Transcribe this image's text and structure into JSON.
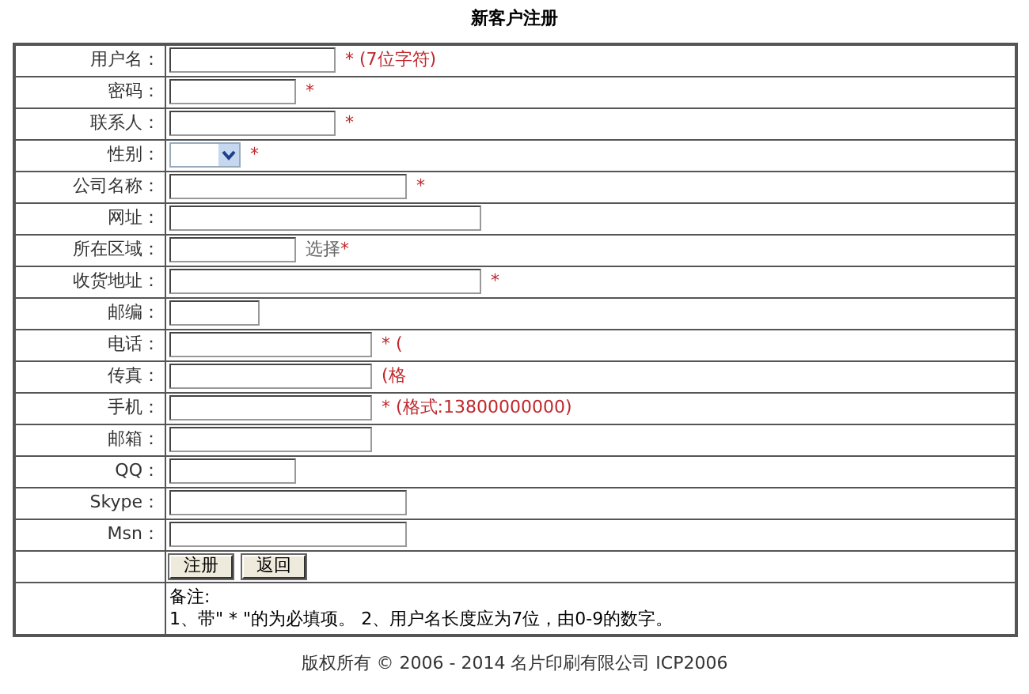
{
  "title": "新客户注册",
  "fields": [
    {
      "label": "用户名：",
      "kind": "text",
      "hint": "* (7位字符)"
    },
    {
      "label": "密码：",
      "kind": "text",
      "hint": "*"
    },
    {
      "label": "联系人：",
      "kind": "text",
      "hint": "*"
    },
    {
      "label": "性别：",
      "kind": "select",
      "hint": "*"
    },
    {
      "label": "公司名称：",
      "kind": "text",
      "hint": "*"
    },
    {
      "label": "网址：",
      "kind": "text"
    },
    {
      "label": "所在区域：",
      "kind": "text",
      "link": "选择",
      "hint": "*"
    },
    {
      "label": "收货地址：",
      "kind": "text",
      "hint": "*"
    },
    {
      "label": "邮编：",
      "kind": "text"
    },
    {
      "label": "电话：",
      "kind": "text",
      "hint": "* ("
    },
    {
      "label": "传真：",
      "kind": "text",
      "hint": "(格"
    },
    {
      "label": "手机：",
      "kind": "text",
      "hint": "* (格式:13800000000)"
    },
    {
      "label": "邮箱：",
      "kind": "text"
    },
    {
      "label": "QQ：",
      "kind": "text"
    },
    {
      "label": "Skype：",
      "kind": "text"
    },
    {
      "label": "Msn：",
      "kind": "text"
    }
  ],
  "buttons": [
    "注册",
    "返回"
  ],
  "notes": {
    "heading": "备注:",
    "text": "1、带\" * \"的为必填项。 2、用户名长度应为7位，由0-9的数字。"
  },
  "footer": "版权所有 © 2006 - 2014 名片印刷有限公司  ICP2006"
}
